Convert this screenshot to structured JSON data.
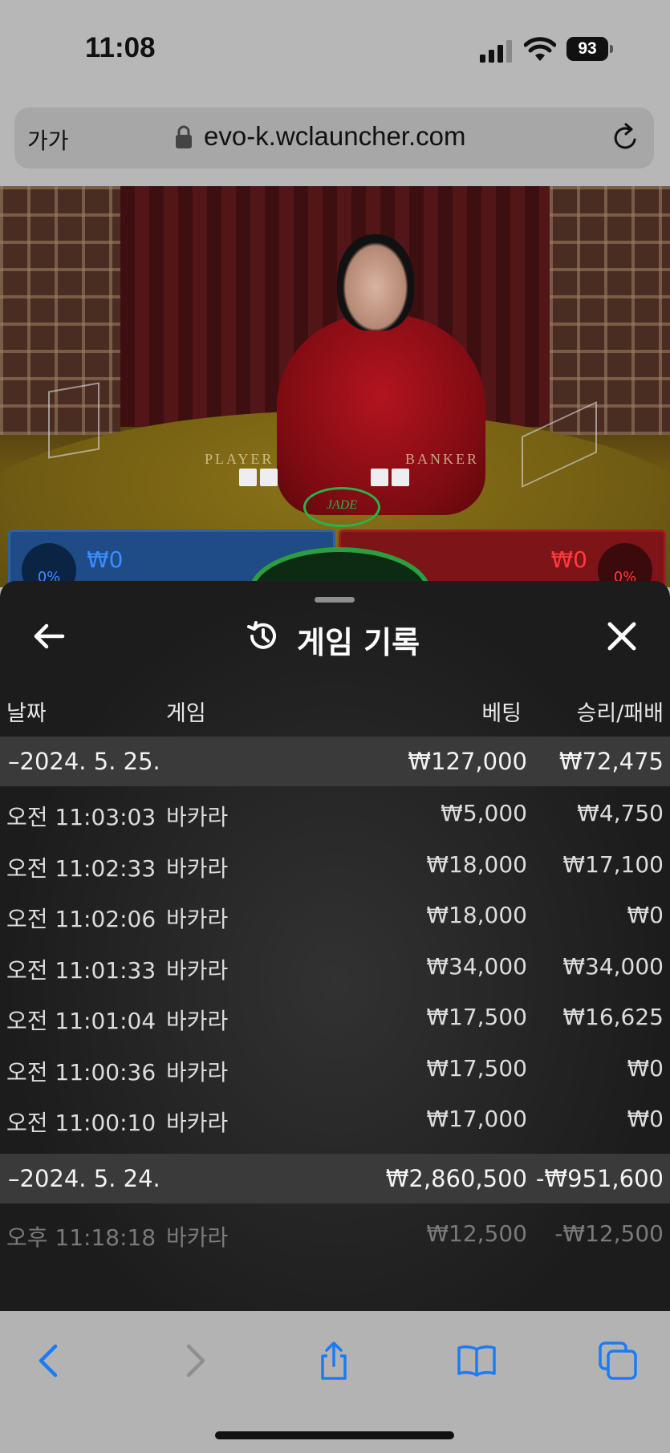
{
  "status_bar": {
    "time": "11:08",
    "battery": "93"
  },
  "browser": {
    "text_size_label": "가가",
    "url": "evo-k.wclauncher.com"
  },
  "video": {
    "player_label": "PLAYER",
    "banker_label": "BANKER",
    "player_amount": "₩0",
    "banker_amount": "₩0",
    "player_percent": "0%",
    "banker_percent": "0%",
    "logo": "JADE"
  },
  "history": {
    "title": "게임 기록",
    "columns": {
      "date": "날짜",
      "game": "게임",
      "bet": "베팅",
      "result": "승리/패배"
    },
    "groups": [
      {
        "date": "–2024. 5. 25.",
        "bet": "₩127,000",
        "result": "₩72,475",
        "rows": [
          {
            "time": "오전 11:03:03",
            "game": "바카라",
            "bet": "₩5,000",
            "result": "₩4,750"
          },
          {
            "time": "오전 11:02:33",
            "game": "바카라",
            "bet": "₩18,000",
            "result": "₩17,100"
          },
          {
            "time": "오전 11:02:06",
            "game": "바카라",
            "bet": "₩18,000",
            "result": "₩0"
          },
          {
            "time": "오전 11:01:33",
            "game": "바카라",
            "bet": "₩34,000",
            "result": "₩34,000"
          },
          {
            "time": "오전 11:01:04",
            "game": "바카라",
            "bet": "₩17,500",
            "result": "₩16,625"
          },
          {
            "time": "오전 11:00:36",
            "game": "바카라",
            "bet": "₩17,500",
            "result": "₩0"
          },
          {
            "time": "오전 11:00:10",
            "game": "바카라",
            "bet": "₩17,000",
            "result": "₩0"
          }
        ]
      },
      {
        "date": "–2024. 5. 24.",
        "bet": "₩2,860,500",
        "result": "-₩951,600",
        "rows": [
          {
            "time": "오후 11:18:18",
            "game": "바카라",
            "bet": "₩12,500",
            "result": "-₩12,500"
          }
        ]
      }
    ]
  },
  "colors": {
    "accent": "#1a7cf5",
    "sheet_bg": "#1c1c1c",
    "group_bg": "#3a3a3a"
  }
}
